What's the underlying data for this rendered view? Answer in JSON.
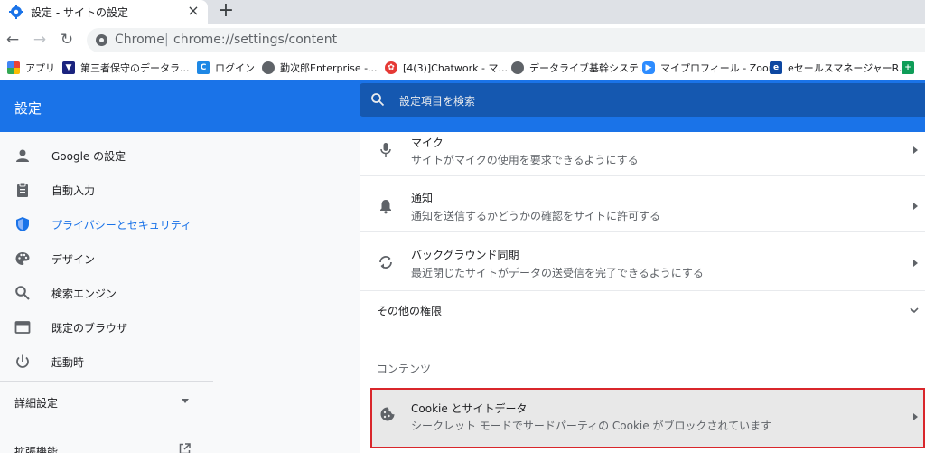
{
  "tab": {
    "title": "設定 - サイトの設定",
    "close": "×",
    "new_tab": "+"
  },
  "toolbar": {
    "back": "←",
    "forward": "→",
    "reload": "↻",
    "host": "Chrome",
    "separator": "|",
    "url": "chrome://settings/content"
  },
  "bookmarks": [
    {
      "label": "アプリ",
      "icon": "apps-icon",
      "color": "#ea4335"
    },
    {
      "label": "第三者保守のデータラ...",
      "icon": "bookmark-icon",
      "color": "#1a237e"
    },
    {
      "label": "ログイン",
      "icon": "login-icon",
      "color": "#1e88e5"
    },
    {
      "label": "勤次郎Enterprise -...",
      "icon": "globe-icon",
      "color": "#5f6368"
    },
    {
      "label": "[4(3)]Chatwork - マ...",
      "icon": "chatwork-icon",
      "color": "#e53935"
    },
    {
      "label": "データライブ基幹システ...",
      "icon": "globe-icon",
      "color": "#5f6368"
    },
    {
      "label": "マイプロフィール - Zoom",
      "icon": "zoom-icon",
      "color": "#2d8cff"
    },
    {
      "label": "eセールスマネージャーR...",
      "icon": "esales-icon",
      "color": "#0d47a1"
    },
    {
      "label": "",
      "icon": "plus-icon",
      "color": "#0f9d58"
    }
  ],
  "header": {
    "title": "設定",
    "search_placeholder": "設定項目を検索"
  },
  "sidebar": {
    "items": [
      {
        "label": "Google の設定",
        "icon": "person-icon"
      },
      {
        "label": "自動入力",
        "icon": "clipboard-icon"
      },
      {
        "label": "プライバシーとセキュリティ",
        "icon": "shield-icon"
      },
      {
        "label": "デザイン",
        "icon": "palette-icon"
      },
      {
        "label": "検索エンジン",
        "icon": "search-icon"
      },
      {
        "label": "既定のブラウザ",
        "icon": "browser-icon"
      },
      {
        "label": "起動時",
        "icon": "power-icon"
      }
    ],
    "advanced": "詳細設定",
    "extensions": "拡張機能"
  },
  "content": {
    "rows": [
      {
        "title": "マイク",
        "subtitle": "サイトがマイクの使用を要求できるようにする",
        "icon": "mic-icon"
      },
      {
        "title": "通知",
        "subtitle": "通知を送信するかどうかの確認をサイトに許可する",
        "icon": "bell-icon"
      },
      {
        "title": "バックグラウンド同期",
        "subtitle": "最近閉じたサイトがデータの送受信を完了できるようにする",
        "icon": "sync-icon"
      }
    ],
    "more_permissions": "その他の権限",
    "section_label": "コンテンツ",
    "cookie": {
      "title": "Cookie とサイトデータ",
      "subtitle": "シークレット モードでサードパーティの Cookie がブロックされています",
      "icon": "cookie-icon"
    }
  },
  "colors": {
    "accent": "#1a73e8",
    "highlight_border": "#d9262b"
  }
}
